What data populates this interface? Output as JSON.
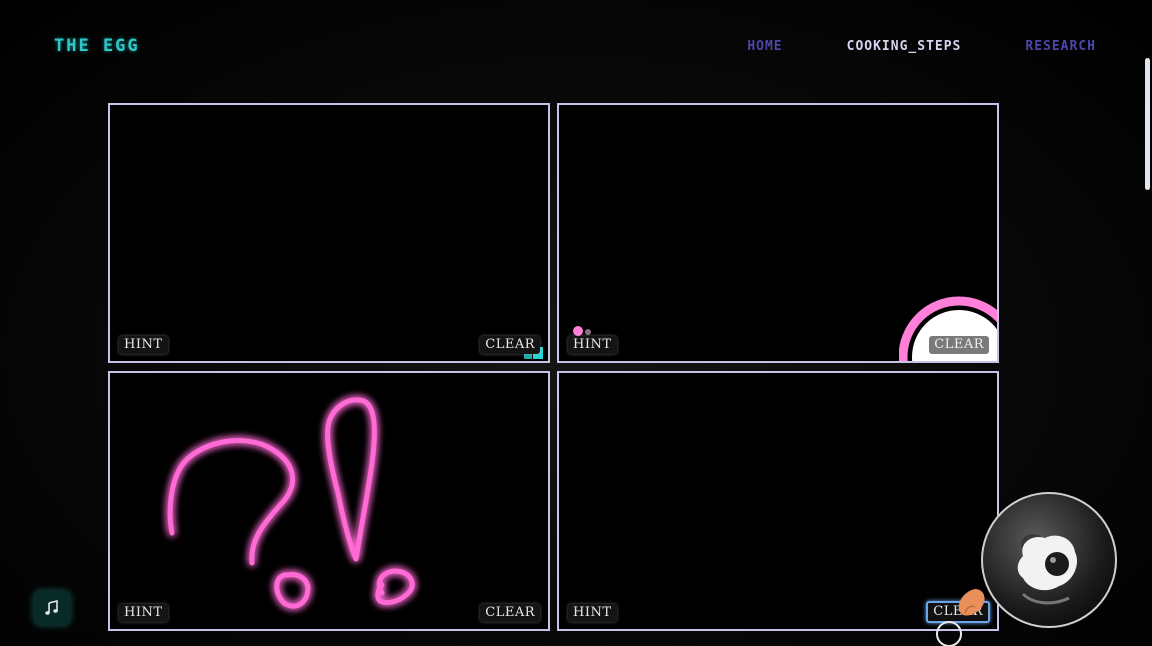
{
  "header": {
    "brand": "THE EGG",
    "nav": [
      {
        "label": "HOME",
        "active": false
      },
      {
        "label": "COOKING_STEPS",
        "active": true
      },
      {
        "label": "RESEARCH",
        "active": false
      }
    ]
  },
  "panels": [
    {
      "hint_label": "HINT",
      "clear_label": "CLEAR"
    },
    {
      "hint_label": "HINT",
      "clear_label": "CLEAR"
    },
    {
      "hint_label": "HINT",
      "clear_label": "CLEAR"
    },
    {
      "hint_label": "HINT",
      "clear_label": "CLEAR"
    }
  ],
  "widgets": {
    "music_icon": "music-note-icon",
    "egg_image": "fried-egg"
  },
  "colors": {
    "brand": "#2ec8c8",
    "nav_inactive": "#4b46a8",
    "nav_active": "#d6d4f0",
    "panel_border": "#c7c2ea",
    "neon_pink": "#ff6ad5",
    "cyan": "#27d3d3"
  }
}
